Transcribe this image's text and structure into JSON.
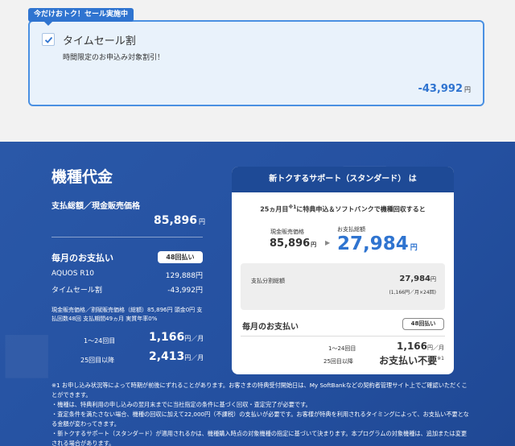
{
  "sale": {
    "tag": "今だけおトク！セール実施中",
    "title": "タイムセール割",
    "subtitle": "時間限定のお申込み対象割引！",
    "amount": "-43,992",
    "yen": "円",
    "checked": true
  },
  "left": {
    "title": "機種代金",
    "total_label": "支払総額／現金販売価格",
    "total_value": "85,896",
    "yen": "円",
    "monthly_label": "毎月のお支払い",
    "monthly_pill": "48回払い",
    "rows": [
      {
        "label": "AQUOS R10",
        "value": "129,888円"
      },
      {
        "label": "タイムセール割",
        "value": "-43,992円"
      }
    ],
    "note": "現金販売価格／割賦販売価格（総額）85,896円 頭金0円 支払回数48回 支払期間49ヵ月 実質年率0%",
    "installments": [
      {
        "label": "1〜24回目",
        "value": "1,166",
        "unit": "円／月"
      },
      {
        "label": "25回目以降",
        "value": "2,413",
        "unit": "円／月"
      }
    ]
  },
  "right": {
    "header": "新トクするサポート（スタンダード） は",
    "sub_pre": "25ヵ月目",
    "sub_mark": "※1",
    "sub_post": "に特典申込＆ソフトバンクで機種回収すると",
    "cash_label": "現金販売価格",
    "cash_value": "85,896",
    "cash_yen": "円",
    "arrow": "▶",
    "pay_label": "お支払総額",
    "pay_value": "27,984",
    "pay_yen": "円",
    "split_label": "支払分割総額",
    "split_value": "27,984",
    "split_yen": "円",
    "split_note": "(1,166円／月×24回)",
    "monthly_label": "毎月のお支払い",
    "monthly_pill": "48回払い",
    "rows": [
      {
        "label": "1〜24回目",
        "value": "1,166",
        "unit": "円／月"
      },
      {
        "label": "25回目以降",
        "value": "お支払い不要",
        "unit": "※1"
      }
    ]
  },
  "footnotes": [
    "※1 お申し込み状況等によって時期が前後にずれることがあります。お客さまの特典受付開始日は、My SoftBankなどの契約者管理サイト上でご確認いただくことができます。",
    "・機種は、特典利用の申し込みの翌月末までに当社指定の条件に基づく回収・査定完了が必要です。",
    "・査定条件を満たさない場合、機種の回収に加えて22,000円（不課税）の支払いが必要です。お客様が特典を利用されるタイミングによって、お支払い不要となる金額が変わってきます。",
    "・新トクするサポート（スタンダード）が適用されるかは、機種購入時点の対象機種の指定に基づいて決まります。本プログラムの対象機種は、追加または変更される場合があります。"
  ]
}
